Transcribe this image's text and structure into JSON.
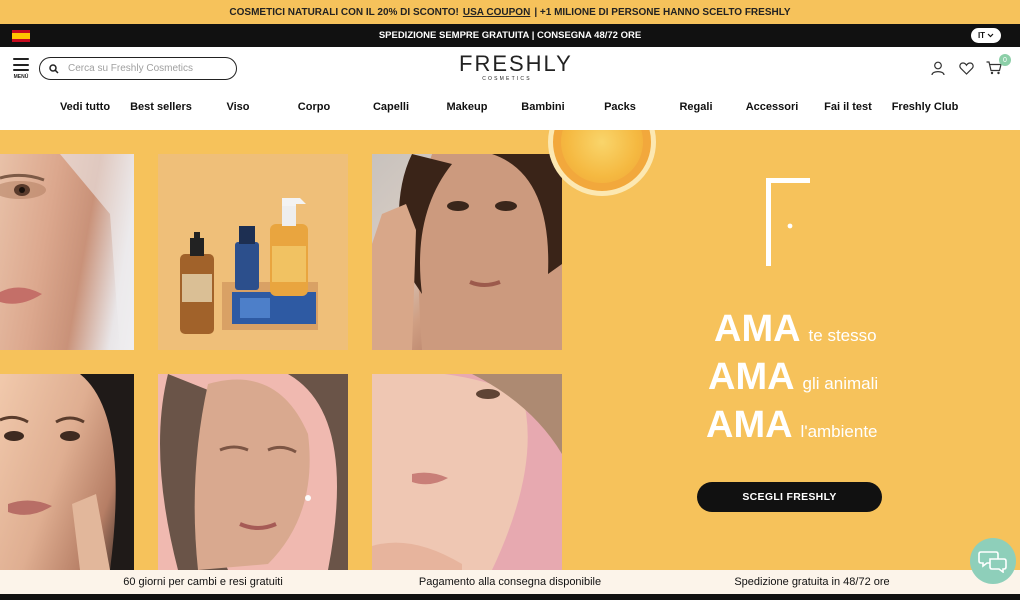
{
  "promo": {
    "text": "COSMETICI NATURALI CON IL 20% DI SCONTO!",
    "link": "USA COUPON",
    "rest": "| +1 MILIONE DI PERSONE HANNO SCELTO FRESHLY"
  },
  "shipping_bar": {
    "text": "SPEDIZIONE SEMPRE GRATUITA | CONSEGNA 48/72 ORE",
    "language": "IT",
    "flag_icon": "spain-flag-icon"
  },
  "header": {
    "menu_label": "MENÚ",
    "search_placeholder": "Cerca su Freshly Cosmetics",
    "logo_word": "FRESHLY",
    "logo_sub": "COSMETICS",
    "cart_count": "0",
    "icons": [
      "user-icon",
      "heart-icon",
      "cart-icon",
      "search-icon",
      "hamburger-icon"
    ]
  },
  "nav": [
    {
      "label": "Vedi tutto"
    },
    {
      "label": "Best sellers"
    },
    {
      "label": "Viso"
    },
    {
      "label": "Corpo"
    },
    {
      "label": "Capelli"
    },
    {
      "label": "Makeup"
    },
    {
      "label": "Bambini"
    },
    {
      "label": "Packs"
    },
    {
      "label": "Regali"
    },
    {
      "label": "Accessori"
    },
    {
      "label": "Fai il test"
    },
    {
      "label": "Freshly Club"
    }
  ],
  "hero": {
    "slogan": [
      {
        "big": "AMA",
        "small": "te stesso"
      },
      {
        "big": "AMA",
        "small": "gli animali"
      },
      {
        "big": "AMA",
        "small": "l'ambiente"
      }
    ],
    "cta": "SCEGLI FRESHLY"
  },
  "benefits": [
    "60 giorni per cambi e resi gratuiti",
    "Pagamento alla consegna disponibile",
    "Spedizione gratuita in 48/72 ore"
  ],
  "colors": {
    "brand_yellow": "#f6c25b",
    "black": "#111111",
    "mint": "#8ecfba",
    "cream": "#fcf4ea"
  }
}
